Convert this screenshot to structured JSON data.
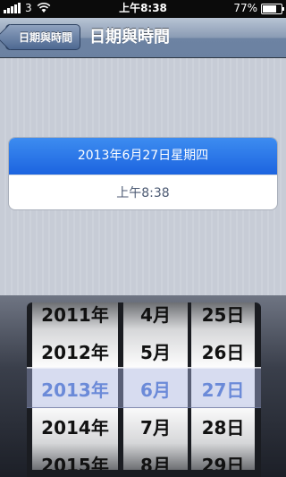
{
  "status": {
    "carrier": "3",
    "time": "上午8:38",
    "battery_percent": "77%",
    "battery_level": 0.77
  },
  "nav": {
    "back_label": "日期與時間",
    "title": "日期與時間"
  },
  "settings": {
    "date_value": "2013年6月27日星期四",
    "time_value": "上午8:38"
  },
  "picker": {
    "years": [
      "2011年",
      "2012年",
      "2013年",
      "2014年",
      "2015年"
    ],
    "months": [
      "4月",
      "5月",
      "6月",
      "7月",
      "8月"
    ],
    "days": [
      "25日",
      "26日",
      "27日",
      "28日",
      "29日"
    ],
    "selected_index": 2,
    "highlight_color": "#3b6ad4"
  }
}
